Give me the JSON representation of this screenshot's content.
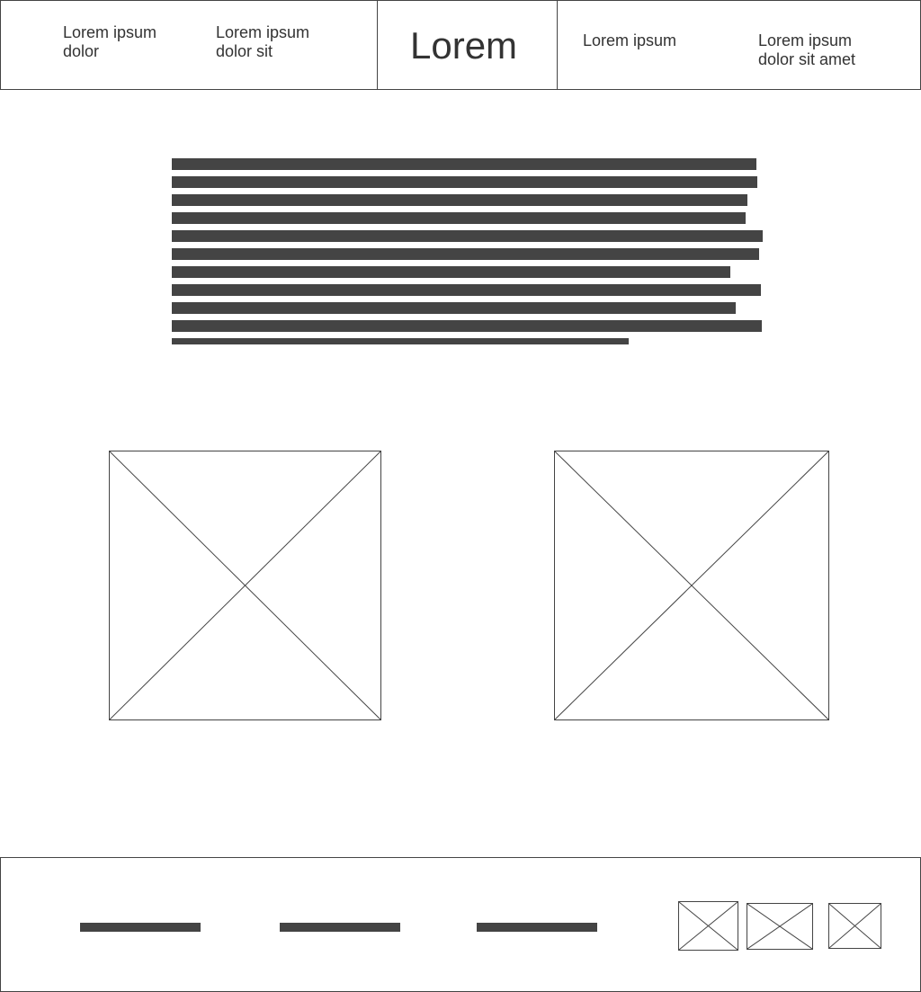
{
  "header": {
    "nav_left": [
      {
        "label": "Lorem ipsum dolor"
      },
      {
        "label": "Lorem ipsum dolor sit"
      }
    ],
    "logo": "Lorem",
    "nav_right": [
      {
        "label": "Lorem ipsum"
      },
      {
        "label": "Lorem ipsum dolor sit amet"
      }
    ]
  },
  "content": {
    "text_block_lines": 11,
    "images": [
      {
        "icon": "image-placeholder-icon"
      },
      {
        "icon": "image-placeholder-icon"
      }
    ]
  },
  "footer": {
    "links": 3,
    "social_icons": [
      {
        "icon": "image-placeholder-icon"
      },
      {
        "icon": "image-placeholder-icon"
      },
      {
        "icon": "image-placeholder-icon"
      }
    ]
  },
  "colors": {
    "border": "#444444",
    "text": "#333333",
    "background": "#ffffff"
  }
}
